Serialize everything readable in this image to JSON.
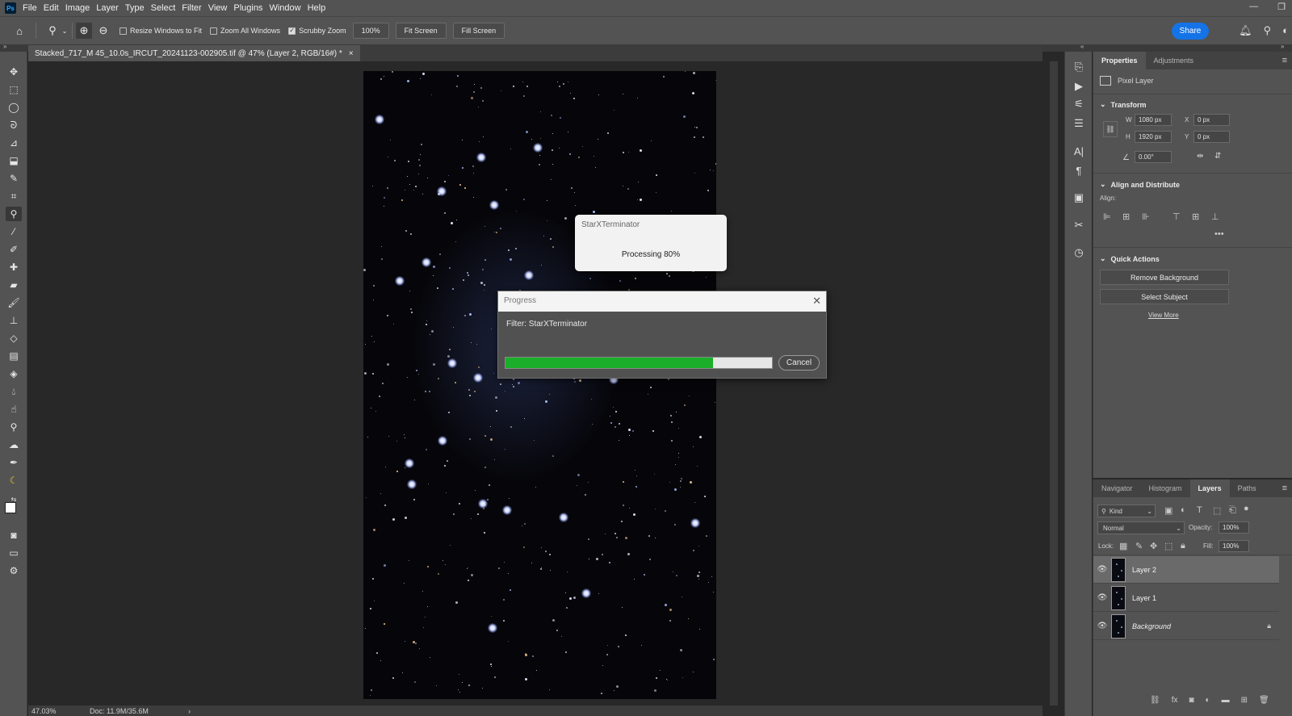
{
  "menu": {
    "logo": "Ps",
    "items": [
      "File",
      "Edit",
      "Image",
      "Layer",
      "Type",
      "Select",
      "Filter",
      "View",
      "Plugins",
      "Window",
      "Help"
    ]
  },
  "options": {
    "resize_windows": "Resize Windows to Fit",
    "zoom_all": "Zoom All Windows",
    "scrubby_zoom": "Scrubby Zoom",
    "zoom_value": "100%",
    "fit_screen": "Fit Screen",
    "fill_screen": "Fill Screen",
    "share": "Share"
  },
  "document": {
    "tab_title": "Stacked_717_M 45_10.0s_IRCUT_20241123-002905.tif @ 47% (Layer 2, RGB/16#) *",
    "zoom": "47.03%",
    "doc_info": "Doc: 11.9M/35.6M"
  },
  "properties": {
    "tabs": [
      "Properties",
      "Adjustments"
    ],
    "layer_type": "Pixel Layer",
    "transform": {
      "title": "Transform",
      "w_label": "W",
      "w": "1080 px",
      "h_label": "H",
      "h": "1920 px",
      "x_label": "X",
      "x": "0 px",
      "y_label": "Y",
      "y": "0 px",
      "angle": "0.00°"
    },
    "align": {
      "title": "Align and Distribute",
      "label": "Align:"
    },
    "quick_actions": {
      "title": "Quick Actions",
      "remove_bg": "Remove Background",
      "select_subject": "Select Subject",
      "view_more": "View More"
    }
  },
  "layers_panel": {
    "tabs": [
      "Navigator",
      "Histogram",
      "Layers",
      "Paths"
    ],
    "filter_kind": "Kind",
    "blend_mode": "Normal",
    "opacity_label": "Opacity:",
    "opacity": "100%",
    "lock_label": "Lock:",
    "fill_label": "Fill:",
    "fill": "100%",
    "layers": [
      {
        "name": "Layer 2",
        "selected": true
      },
      {
        "name": "Layer 1",
        "selected": false
      },
      {
        "name": "Background",
        "selected": false,
        "locked": true
      }
    ]
  },
  "stx_dialog": {
    "title": "StarXTerminator",
    "message": "Processing 80%"
  },
  "progress_dialog": {
    "title": "Progress",
    "filter_text": "Filter: StarXTerminator",
    "progress": 0.78,
    "cancel": "Cancel"
  },
  "colors": {
    "progress_fill": "#1aae2a",
    "share": "#1473e6"
  }
}
